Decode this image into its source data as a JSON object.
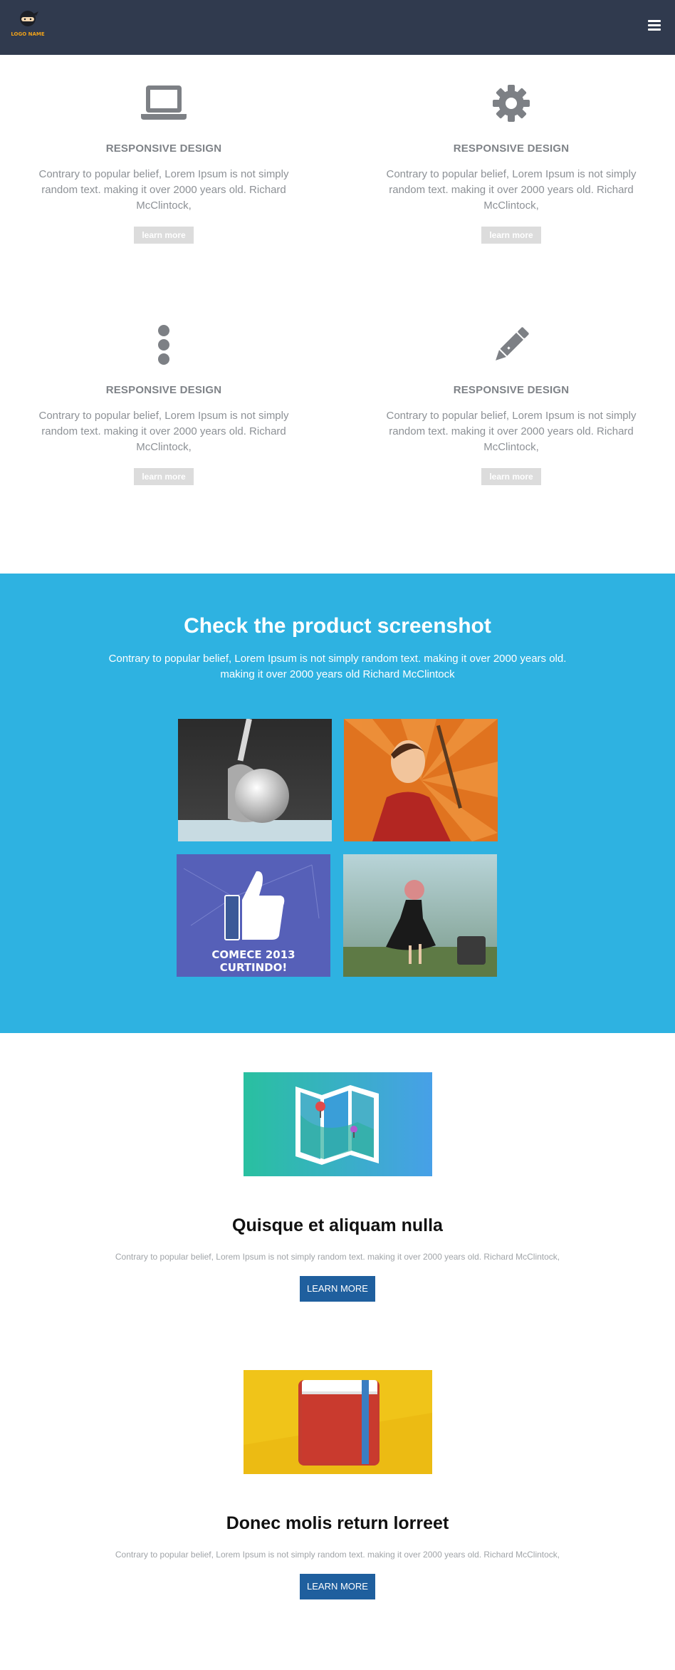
{
  "header": {
    "logo_text": "LOGO NAME"
  },
  "features": [
    {
      "icon": "laptop-icon",
      "title": "RESPONSIVE DESIGN",
      "text": "Contrary to popular belief, Lorem Ipsum is not simply random text. making it over 2000 years old. Richard McClintock,",
      "button": "learn more"
    },
    {
      "icon": "gear-icon",
      "title": "RESPONSIVE DESIGN",
      "text": "Contrary to popular belief, Lorem Ipsum is not simply random text. making it over 2000 years old. Richard McClintock,",
      "button": "learn more"
    },
    {
      "icon": "vertical-dots-icon",
      "title": "RESPONSIVE DESIGN",
      "text": "Contrary to popular belief, Lorem Ipsum is not simply random text. making it over 2000 years old. Richard McClintock,",
      "button": "learn more"
    },
    {
      "icon": "pencil-icon",
      "title": "RESPONSIVE DESIGN",
      "text": "Contrary to popular belief, Lorem Ipsum is not simply random text. making it over 2000 years old. Richard McClintock,",
      "button": "learn more"
    }
  ],
  "screenshots": {
    "title": "Check the product screenshot",
    "lead": "Contrary to popular belief, Lorem Ipsum is not simply random text. making it over 2000 years old. making it over 2000 years old Richard McClintock",
    "images": [
      {
        "name": "golf-club-image"
      },
      {
        "name": "poster-man-image"
      },
      {
        "name": "facebook-like-image",
        "caption": "COMECE 2013 CURTINDO!"
      },
      {
        "name": "woman-dancing-image"
      }
    ]
  },
  "promos": [
    {
      "image": "map-image",
      "title": "Quisque et aliquam nulla",
      "text": "Contrary to popular belief, Lorem Ipsum is not simply random text. making it over 2000 years old. Richard McClintock,",
      "button": "LEARN MORE"
    },
    {
      "image": "book-image",
      "title": "Donec molis return lorreet",
      "text": "Contrary to popular belief, Lorem Ipsum is not simply random text. making it over 2000 years old. Richard McClintock,",
      "button": "LEARN MORE"
    }
  ],
  "colors": {
    "navbar": "#303a4e",
    "accent_blue": "#2eb2e1",
    "button_blue": "#1f5f9e",
    "logo_orange": "#f0a21a"
  }
}
